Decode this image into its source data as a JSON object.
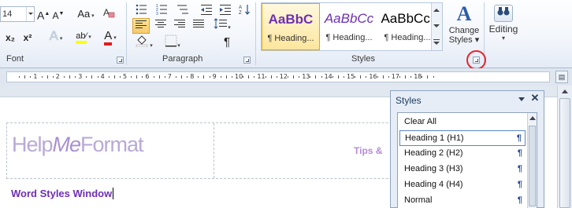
{
  "ribbon": {
    "font_group": {
      "label": "Font",
      "font_size": "14",
      "grow_font": "A",
      "shrink_font": "A",
      "change_case": "Aa",
      "subscript": "x₂",
      "superscript": "x²",
      "text_effects": "A",
      "highlight": "ab⁄",
      "font_color": "A"
    },
    "paragraph_group": {
      "label": "Paragraph",
      "show_marks": "¶"
    },
    "styles_group": {
      "label": "Styles",
      "gallery": [
        {
          "sample": "AaBbC",
          "name": "¶ Heading...",
          "color": "#6d2fb5",
          "bold": true,
          "italic": false
        },
        {
          "sample": "AaBbCc",
          "name": "¶ Heading...",
          "color": "#6d2fb5",
          "bold": false,
          "italic": true
        },
        {
          "sample": "AaBbCcI",
          "name": "¶ Heading...",
          "color": "#000000",
          "bold": false,
          "italic": false
        }
      ],
      "change_styles_icon": "A",
      "change_styles_line1": "Change",
      "change_styles_line2": "Styles ▾"
    },
    "editing": {
      "label": "Editing",
      "icon": "binoculars-icon"
    }
  },
  "ruler": {
    "numbers": [
      "1",
      "2",
      "3",
      "4",
      "5",
      "6",
      "7",
      "8",
      "9",
      "10",
      "11",
      "12",
      "13",
      "14",
      "15",
      "16",
      "17",
      "18"
    ]
  },
  "document": {
    "logo_help": "Help",
    "logo_me": "Me",
    "logo_format": "Format",
    "tagline": "Tips &",
    "heading": "Word Styles Window"
  },
  "styles_pane": {
    "title": "Styles",
    "close": "✕",
    "items": [
      {
        "label": "Clear All",
        "mark": ""
      },
      {
        "label": "Heading 1 (H1)",
        "mark": "¶",
        "selected": true
      },
      {
        "label": "Heading 2 (H2)",
        "mark": "¶"
      },
      {
        "label": "Heading 3 (H3)",
        "mark": "¶"
      },
      {
        "label": "Heading 4 (H4)",
        "mark": "¶"
      },
      {
        "label": "Normal",
        "mark": "¶"
      }
    ]
  },
  "colors": {
    "accent_purple": "#6d2fb5",
    "highlight_circle": "#e3262d",
    "selection_gold": "#e5a900"
  }
}
